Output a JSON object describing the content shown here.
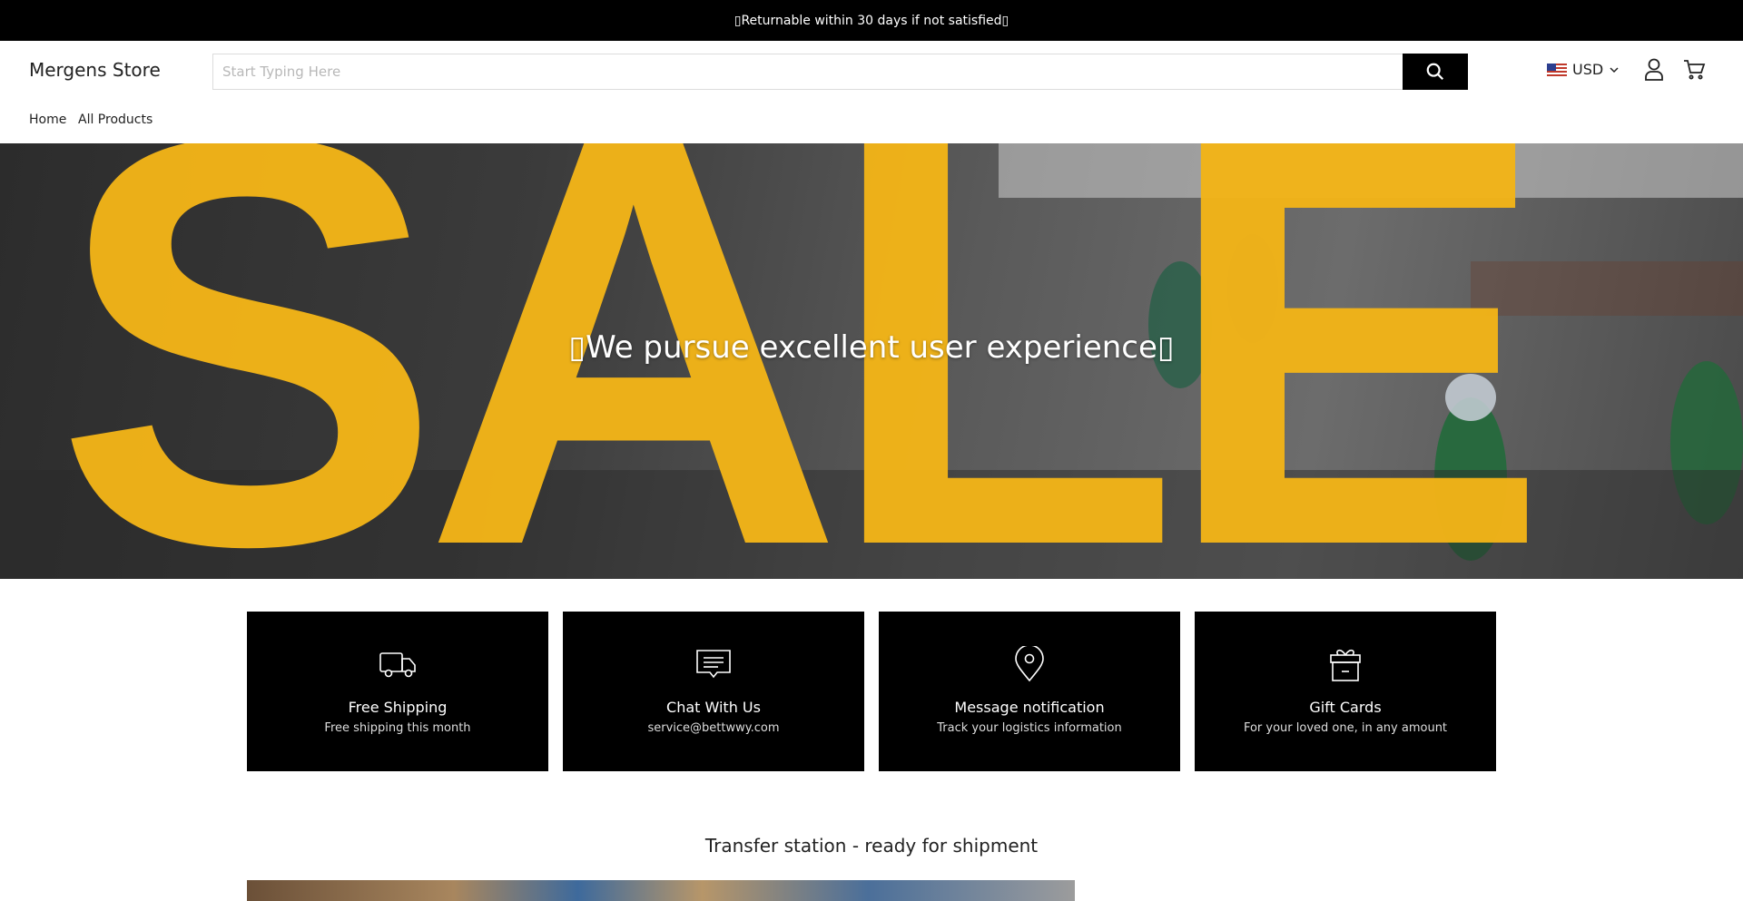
{
  "announcement": "▯Returnable within 30 days if not satisfied▯",
  "header": {
    "logo": "Mergens Store",
    "search_placeholder": "Start Typing Here",
    "currency": "USD"
  },
  "nav": {
    "items": [
      "Home",
      "All Products"
    ]
  },
  "hero": {
    "title": "▯We pursue excellent user experience▯",
    "background_word": "SALE",
    "accent": "#f2b418"
  },
  "features": [
    {
      "icon": "truck-icon",
      "title": "Free Shipping",
      "subtitle": "Free shipping this month"
    },
    {
      "icon": "chat-icon",
      "title": "Chat With Us",
      "subtitle": "service@bettwwy.com"
    },
    {
      "icon": "map-pin-icon",
      "title": "Message notification",
      "subtitle": "Track your logistics information"
    },
    {
      "icon": "gift-icon",
      "title": "Gift Cards",
      "subtitle": "For your loved one, in any amount"
    }
  ],
  "section": {
    "title": "Transfer station - ready for shipment"
  }
}
